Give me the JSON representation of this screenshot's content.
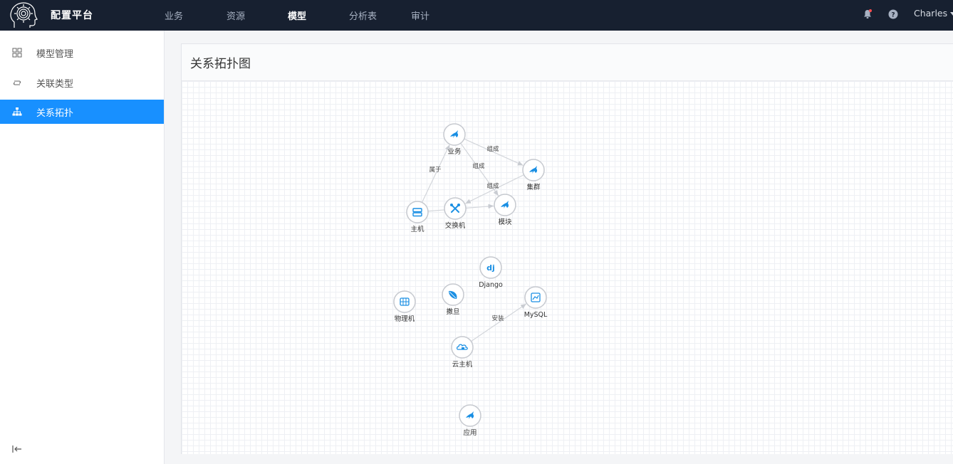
{
  "app": {
    "brand": "配置平台",
    "nav": [
      {
        "label": "业务",
        "active": false
      },
      {
        "label": "资源",
        "active": false
      },
      {
        "label": "模型",
        "active": true
      },
      {
        "label": "分析表",
        "active": false
      },
      {
        "label": "审计",
        "active": false
      }
    ],
    "user": "Charles"
  },
  "sidebar": {
    "items": [
      {
        "label": "模型管理",
        "icon": "grid-icon",
        "active": false
      },
      {
        "label": "关联类型",
        "icon": "link-icon",
        "active": false
      },
      {
        "label": "关系拓扑",
        "icon": "sitemap-icon",
        "active": true
      }
    ]
  },
  "panel": {
    "title": "关系拓扑图"
  },
  "topology": {
    "nodes": [
      {
        "id": "biz",
        "label": "业务",
        "icon": "bird-icon"
      },
      {
        "id": "cluster",
        "label": "集群",
        "icon": "bird-icon"
      },
      {
        "id": "host",
        "label": "主机",
        "icon": "server-icon"
      },
      {
        "id": "switch",
        "label": "交换机",
        "icon": "tools-icon"
      },
      {
        "id": "module",
        "label": "模块",
        "icon": "bird-icon"
      },
      {
        "id": "django",
        "label": "Django",
        "icon": "dj-icon"
      },
      {
        "id": "physical",
        "label": "物理机",
        "icon": "cabinet-icon"
      },
      {
        "id": "sajun",
        "label": "撒旦",
        "icon": "leaf-icon"
      },
      {
        "id": "mysql",
        "label": "MySQL",
        "icon": "chart-icon"
      },
      {
        "id": "cloudhost",
        "label": "云主机",
        "icon": "cloud-icon"
      },
      {
        "id": "app",
        "label": "应用",
        "icon": "bird-icon"
      }
    ],
    "edges": [
      {
        "from": "biz",
        "to": "cluster",
        "label": "组成"
      },
      {
        "from": "biz",
        "to": "module",
        "label": "组成"
      },
      {
        "from": "cluster",
        "to": "switch",
        "label": "组成"
      },
      {
        "from": "host",
        "to": "biz",
        "label": "属于"
      },
      {
        "from": "host",
        "to": "module",
        "label": ""
      },
      {
        "from": "cloudhost",
        "to": "mysql",
        "label": "安装"
      }
    ]
  },
  "colors": {
    "topbar": "#172030",
    "accent": "#1890ff",
    "node_icon": "#1a8fe3"
  }
}
